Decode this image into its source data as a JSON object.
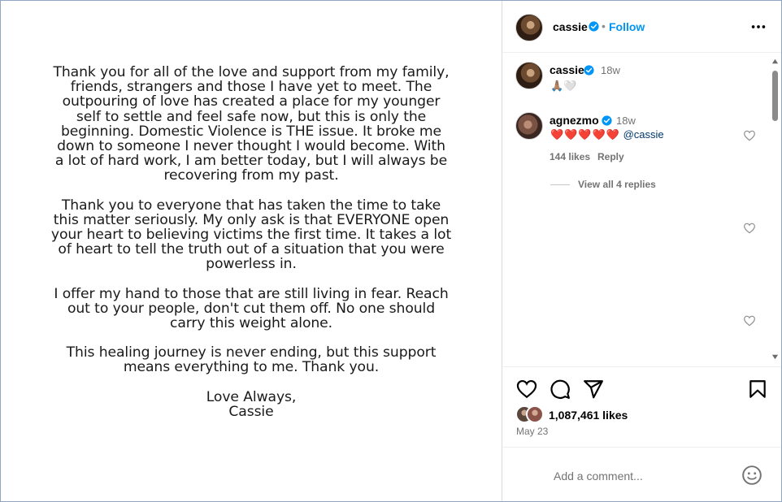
{
  "post": {
    "paragraphs": [
      "Thank you for all of the love and support from my family,\nfriends, strangers and those I have yet to meet. The\noutpouring of love has created a place for my younger\nself to settle and feel safe now, but this is only the\nbeginning. Domestic Violence is THE issue. It broke me\ndown to someone I never thought I would become. With\na lot of hard work, I am better today, but I will always be\nrecovering from my past.",
      "Thank you to everyone that has taken the time to take\nthis matter seriously. My only ask is that EVERYONE open\nyour heart to believing victims the first time. It takes a lot\nof heart to tell the truth out of a situation that you were\npowerless in.",
      "I offer my hand to those that are still living in fear. Reach\nout to your people, don't cut them off. No one should\ncarry this weight alone.",
      "This healing journey is never ending, but this support\nmeans everything to me. Thank you.",
      "Love Always,\nCassie"
    ]
  },
  "header": {
    "username": "cassie",
    "separator": "•",
    "follow_label": "Follow"
  },
  "caption": {
    "username": "cassie",
    "time": "18w",
    "emojis": "🙏🏽🤍"
  },
  "comment": {
    "username": "agnezmo",
    "time": "18w",
    "hearts": "❤️❤️❤️❤️❤️",
    "mention": "@cassie",
    "likes": "144 likes",
    "reply_label": "Reply",
    "view_replies": "View all 4 replies"
  },
  "footer": {
    "likes": "1,087,461 likes",
    "date": "May 23",
    "add_comment_placeholder": "Add a comment..."
  },
  "colors": {
    "accent": "#0095f6",
    "verified": "#0095f6",
    "muted": "#737373",
    "mention": "#00376b"
  },
  "icons": [
    "verified-badge-icon",
    "more-options-icon",
    "heart-icon",
    "comment-icon",
    "share-icon",
    "bookmark-icon",
    "emoji-icon",
    "scroll-up-icon",
    "scroll-down-icon"
  ]
}
